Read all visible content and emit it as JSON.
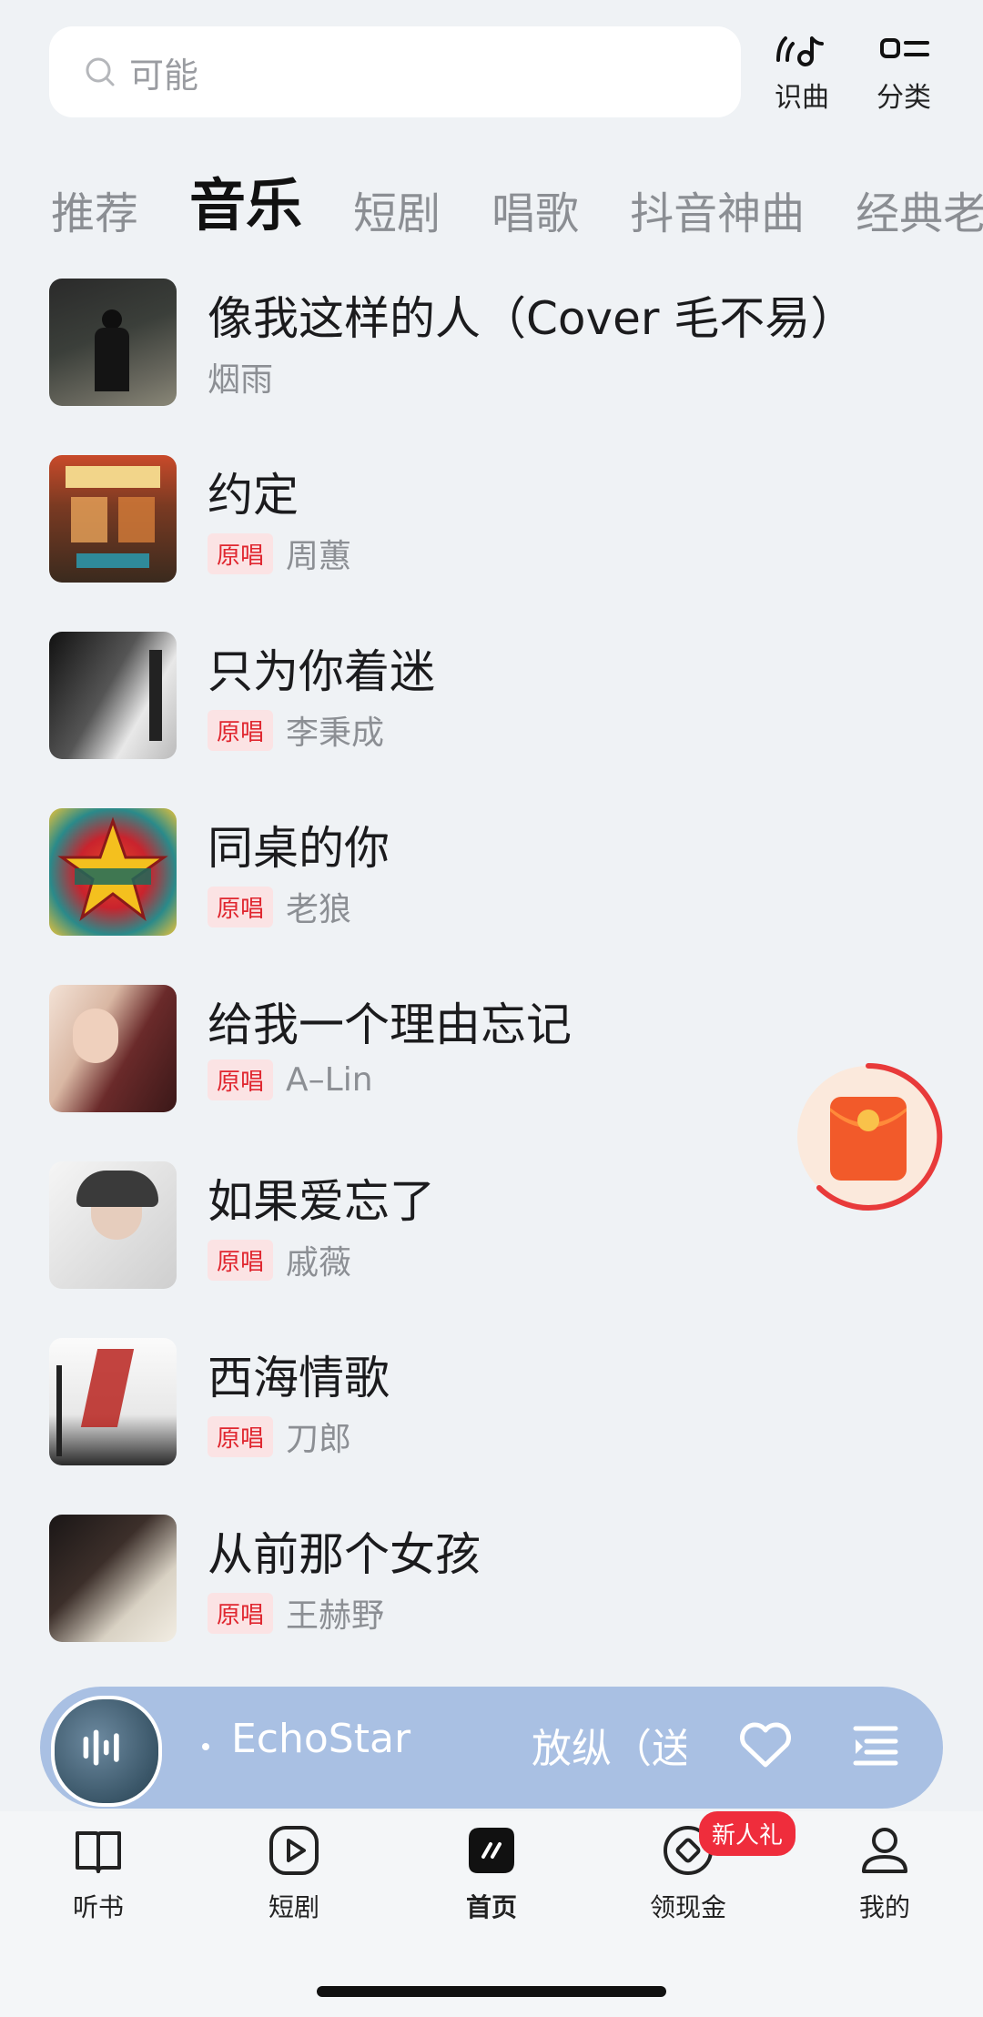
{
  "search": {
    "placeholder": "可能"
  },
  "header_tools": {
    "identify_label": "识曲",
    "category_label": "分类"
  },
  "tabs": [
    "推荐",
    "音乐",
    "短剧",
    "唱歌",
    "抖音神曲",
    "经典老"
  ],
  "active_tab": "音乐",
  "songs": [
    {
      "title": "像我这样的人（Cover 毛不易）",
      "artist": "烟雨",
      "badge": ""
    },
    {
      "title": "约定",
      "artist": "周蕙",
      "badge": "原唱"
    },
    {
      "title": "只为你着迷",
      "artist": "李秉成",
      "badge": "原唱"
    },
    {
      "title": "同桌的你",
      "artist": "老狼",
      "badge": "原唱"
    },
    {
      "title": "给我一个理由忘记",
      "artist": "A–Lin",
      "badge": "原唱"
    },
    {
      "title": "如果爱忘了",
      "artist": "戚薇",
      "badge": "原唱"
    },
    {
      "title": "西海情歌",
      "artist": "刀郎",
      "badge": "原唱"
    },
    {
      "title": "从前那个女孩",
      "artist": "王赫野",
      "badge": "原唱"
    }
  ],
  "player": {
    "artist": "EchoStar",
    "song": "放纵（送"
  },
  "nav": {
    "items": [
      "听书",
      "短剧",
      "首页",
      "领现金",
      "我的"
    ],
    "badge": "新人礼"
  },
  "colors": {
    "accent": "#e0262f",
    "player_bg": "#a9c0e3"
  }
}
